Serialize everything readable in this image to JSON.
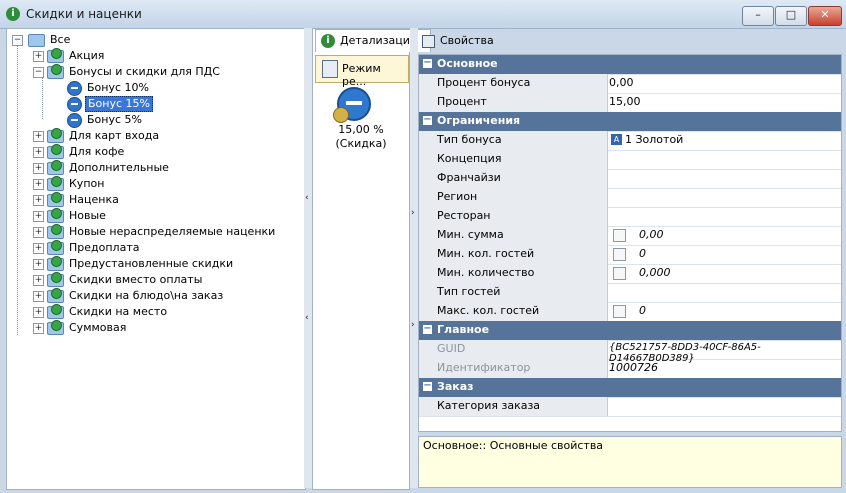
{
  "window": {
    "title": "Скидки и наценки"
  },
  "tree": {
    "root": "Все",
    "items": [
      {
        "label": "Акция"
      },
      {
        "label": "Бонусы и скидки для ПДС",
        "children": [
          "Бонус 10%",
          "Бонус 15%",
          "Бонус 5%"
        ]
      },
      {
        "label": "Для карт входа"
      },
      {
        "label": "Для кофе"
      },
      {
        "label": "Дополнительные"
      },
      {
        "label": "Купон"
      },
      {
        "label": "Наценка"
      },
      {
        "label": "Новые"
      },
      {
        "label": "Новые нераспределяемые наценки"
      },
      {
        "label": "Предоплата"
      },
      {
        "label": "Предустановленные скидки"
      },
      {
        "label": "Скидки вместо оплаты"
      },
      {
        "label": "Скидки на блюдо\\на заказ"
      },
      {
        "label": "Скидки на место"
      },
      {
        "label": "Суммовая"
      }
    ],
    "selected": "Бонус 15%"
  },
  "middle": {
    "tab": "Детализации",
    "mode_button": "Режим ре...",
    "item_line1": "15,00 %",
    "item_line2": "(Скидка)"
  },
  "properties_tab": "Свойства",
  "grid": {
    "cat_basic": "Основное",
    "bonus_percent_label": "Процент бонуса",
    "bonus_percent_value": "0,00",
    "percent_label": "Процент",
    "percent_value": "15,00",
    "cat_limits": "Ограничения",
    "bonus_type_label": "Тип бонуса",
    "bonus_type_value": "1 Золотой",
    "concept_label": "Концепция",
    "franchise_label": "Франчайзи",
    "region_label": "Регион",
    "restaurant_label": "Ресторан",
    "min_sum_label": "Мин. сумма",
    "min_sum_value": "0,00",
    "min_guests_label": "Мин. кол. гостей",
    "min_guests_value": "0",
    "min_qty_label": "Мин. количество",
    "min_qty_value": "0,000",
    "guest_type_label": "Тип гостей",
    "max_guests_label": "Макс. кол. гостей",
    "max_guests_value": "0",
    "cat_main": "Главное",
    "guid_label": "GUID",
    "guid_value": "{BC521757-8DD3-40CF-86A5-D14667B0D389}",
    "id_label": "Идентификатор",
    "id_value": "1000726",
    "cat_order": "Заказ",
    "order_cat_label": "Категория заказа"
  },
  "description": "Основное:: Основные свойства"
}
